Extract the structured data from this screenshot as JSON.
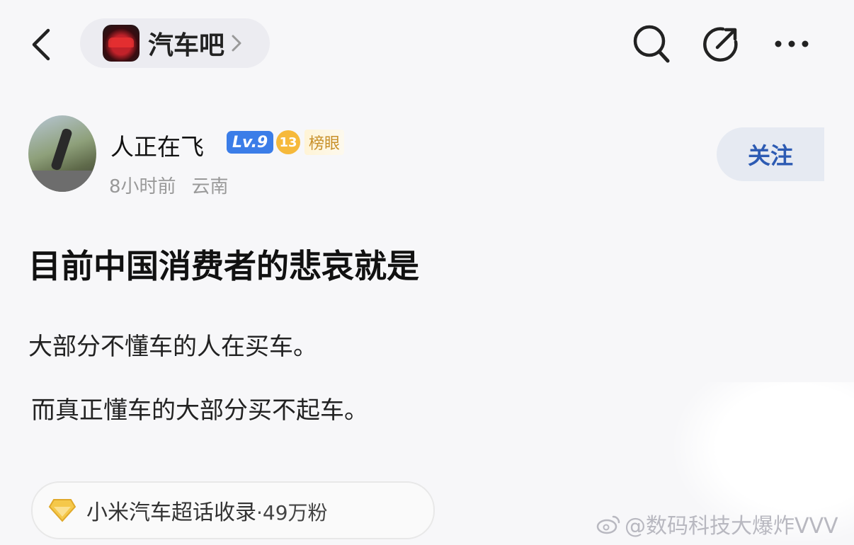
{
  "header": {
    "forum_name": "汽车吧",
    "icons": [
      "back-icon",
      "forum-logo",
      "chevron-right-icon",
      "search-icon",
      "edit-share-icon",
      "more-icon"
    ]
  },
  "author": {
    "name": "人正在飞",
    "level_badge": "Lv.9",
    "rank_number": "13",
    "rank_label": "榜眼",
    "time": "8小时前",
    "location": "云南",
    "follow_label": "关注"
  },
  "post": {
    "title": "目前中国消费者的悲哀就是",
    "lines": [
      "大部分不懂车的人在买车。",
      "而真正懂车的大部分买不起车。"
    ]
  },
  "topic": {
    "name": "小米汽车超话收录",
    "count": "·49万粉"
  },
  "watermark": {
    "text": "@数码科技大爆炸VVV"
  },
  "colors": {
    "accent": "#3b7de8",
    "follow_text": "#2d5bb3",
    "rank_gold": "#f6b93b"
  }
}
